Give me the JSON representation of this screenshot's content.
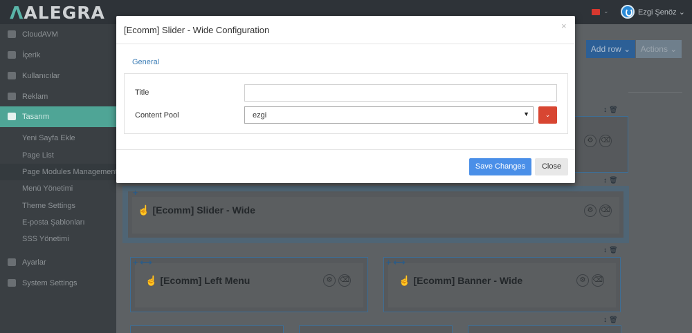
{
  "app": {
    "logo_text": "ALEGRA",
    "user_name": "Ezgi Şenöz"
  },
  "sidebar": {
    "items": [
      {
        "label": "CloudAVM",
        "icon": "cloud-icon"
      },
      {
        "label": "İçerik",
        "icon": "database-icon"
      },
      {
        "label": "Kullanıcılar",
        "icon": "user-icon"
      },
      {
        "label": "Reklam",
        "icon": "cart-icon"
      },
      {
        "label": "Tasarım",
        "icon": "monitor-icon",
        "active": true
      },
      {
        "label": "Ayarlar",
        "icon": "wrench-icon"
      },
      {
        "label": "System Settings",
        "icon": "sitemap-icon"
      }
    ],
    "sub_items": [
      {
        "label": "Yeni Sayfa Ekle"
      },
      {
        "label": "Page List"
      },
      {
        "label": "Page Modules Management",
        "highlighted": true
      },
      {
        "label": "Menü Yönetimi"
      },
      {
        "label": "Theme Settings"
      },
      {
        "label": "E-posta Şablonları"
      },
      {
        "label": "SSS Yönetimi"
      }
    ]
  },
  "toolbar": {
    "add_row_label": "Add row ⌄",
    "actions_label": "Actions ⌄"
  },
  "modules": {
    "slider_wide": "[Ecomm] Slider - Wide",
    "left_menu": "[Ecomm] Left Menu",
    "banner_wide": "[Ecomm] Banner - Wide"
  },
  "modal": {
    "title": "[Ecomm] Slider - Wide Configuration",
    "close_glyph": "×",
    "section_tab": "General",
    "title_label": "Title",
    "title_value": "",
    "content_pool_label": "Content Pool",
    "content_pool_value": "ezgi",
    "save_label": "Save Changes",
    "close_label": "Close"
  },
  "colors": {
    "save_button": "#4a8fe8",
    "dropdown_button": "#d84632",
    "active_sidebar": "#4fa596",
    "section_tab": "#3d7eb6"
  }
}
